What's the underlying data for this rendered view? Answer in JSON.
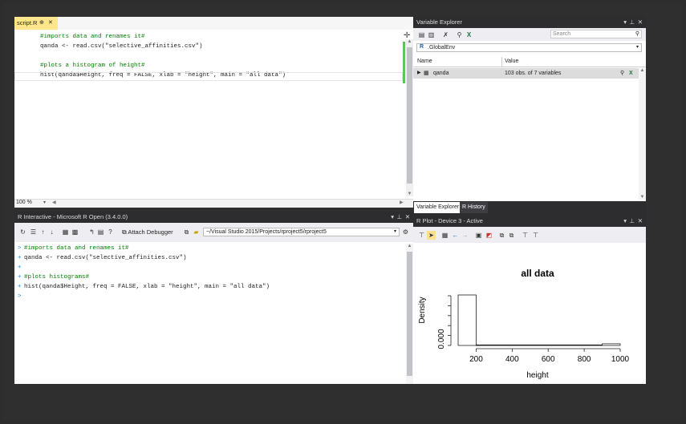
{
  "editor": {
    "tab_label": "script.R",
    "pin_glyph": "⊕",
    "close_glyph": "✕",
    "lines": [
      {
        "text": "#imports data and renames it#",
        "kind": "comment"
      },
      {
        "text": "qanda <- read.csv(\"selective_affinities.csv\")",
        "kind": "code"
      },
      {
        "text": "",
        "kind": "code"
      },
      {
        "text": "#plots a histogram of height#",
        "kind": "comment"
      },
      {
        "text": "hist(qanda$Height, freq = FALSE, xlab = \"height\", main = \"all data\")",
        "kind": "code"
      }
    ],
    "zoom": "100 %"
  },
  "variable_explorer": {
    "title": "Variable Explorer",
    "search_placeholder": "Search",
    "environment": ".GlobalEnv",
    "columns": {
      "name": "Name",
      "value": "Value"
    },
    "rows": [
      {
        "name": "qanda",
        "value": "103 obs. of  7 variables"
      }
    ],
    "tabs": [
      "Variable Explorer",
      "R History"
    ]
  },
  "r_interactive": {
    "title": "R Interactive - Microsoft R Open (3.4.0.0)",
    "attach_label": "Attach Debugger",
    "path": "~/Visual Studio 2015/Projects/rproject5/rproject5",
    "lines": [
      {
        "prompt": ">",
        "text": "#imports data and renames it#",
        "kind": "comment"
      },
      {
        "prompt": "+",
        "text": "qanda <- read.csv(\"selective_affinities.csv\")",
        "kind": "code"
      },
      {
        "prompt": "+",
        "text": "",
        "kind": "code"
      },
      {
        "prompt": "+",
        "text": "#plots histograms#",
        "kind": "comment"
      },
      {
        "prompt": "+",
        "text": "hist(qanda$Height, freq = FALSE, xlab = \"height\", main = \"all data\")",
        "kind": "code"
      },
      {
        "prompt": ">",
        "text": "",
        "kind": "code"
      }
    ]
  },
  "r_plot": {
    "title": "R Plot - Device 3 - Active"
  },
  "chart_data": {
    "type": "bar",
    "title": "all data",
    "xlabel": "height",
    "ylabel": "Density",
    "x_ticks": [
      200,
      400,
      600,
      800,
      1000
    ],
    "y_tick_label": "0.000",
    "xlim": [
      100,
      1000
    ],
    "bins": [
      {
        "x0": 100,
        "x1": 200,
        "density": 0.009
      },
      {
        "x0": 200,
        "x1": 900,
        "density": 0.0001
      },
      {
        "x0": 900,
        "x1": 1000,
        "density": 0.0003
      }
    ],
    "ylim": [
      0,
      0.01
    ]
  },
  "colors": {
    "accent_blue": "#007acc",
    "tab_yellow": "#ffe58c",
    "comment_green": "#008000",
    "string_red": "#a31515",
    "keyword_blue": "#0000ff",
    "chrome_dark": "#2d2d30",
    "change_bar": "#5ec25e",
    "console_prompt": "#1c8de0"
  }
}
